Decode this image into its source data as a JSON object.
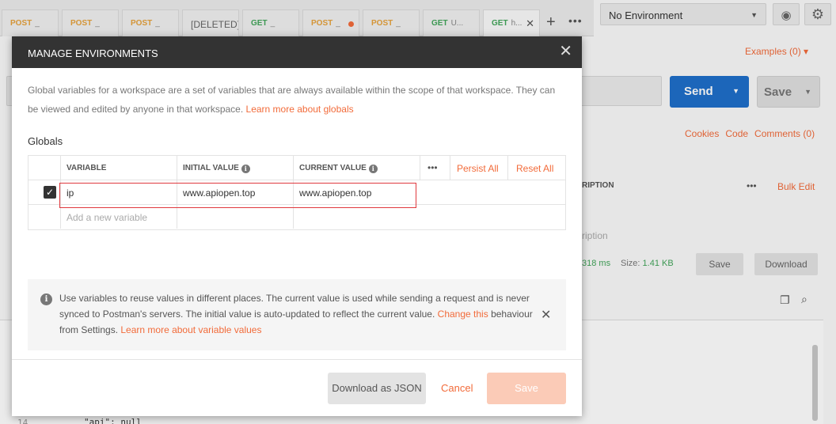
{
  "tabs": [
    {
      "method": "POST",
      "name": "_"
    },
    {
      "method": "POST",
      "name": "_"
    },
    {
      "method": "POST",
      "name": "_"
    },
    {
      "method": "",
      "name": "[DELETED] F"
    },
    {
      "method": "GET",
      "name": "_"
    },
    {
      "method": "POST",
      "name": "_"
    },
    {
      "method": "POST",
      "name": "_"
    },
    {
      "method": "GET",
      "name": "U..."
    },
    {
      "method": "GET",
      "name": "h..."
    }
  ],
  "environment": {
    "selected": "No Environment"
  },
  "background": {
    "examples": "Examples (0)",
    "send": "Send",
    "save": "Save",
    "links": [
      "Cookies",
      "Code",
      "Comments (0)"
    ],
    "description_header": "RIPTION",
    "bulk_edit": "Bulk Edit",
    "description_placeholder": "ription",
    "time": "318 ms",
    "size_label": "Size:",
    "size_value": "1.41 KB",
    "save_response": "Save",
    "download": "Download",
    "line_number": "14",
    "code_line": "\"api\": null"
  },
  "modal": {
    "title": "MANAGE ENVIRONMENTS",
    "intro_text": "Global variables for a workspace are a set of variables that are always available within the scope of that workspace. They can be viewed and edited by anyone in that workspace.",
    "intro_link": "Learn more about globals",
    "section_title": "Globals",
    "table": {
      "headers": {
        "variable": "VARIABLE",
        "initial_value": "INITIAL VALUE",
        "current_value": "CURRENT VALUE",
        "persist_all": "Persist All",
        "reset_all": "Reset All"
      },
      "rows": [
        {
          "variable": "ip",
          "initial_value": "www.apiopen.top",
          "current_value": "www.apiopen.top"
        }
      ],
      "new_row_placeholder": "Add a new variable"
    },
    "note": {
      "text_1": "Use variables to reuse values in different places. The current value is used while sending a request and is never synced to Postman's servers. The initial value is auto-updated to reflect the current value.",
      "link_1": "Change this",
      "text_2": "behaviour from Settings.",
      "link_2": "Learn more about variable values"
    },
    "footer": {
      "download_json": "Download as JSON",
      "cancel": "Cancel",
      "save": "Save"
    }
  },
  "colors": {
    "accent": "#f26b3a",
    "primary": "#1f6fca",
    "header": "#333333",
    "highlight": "#e0393e"
  }
}
